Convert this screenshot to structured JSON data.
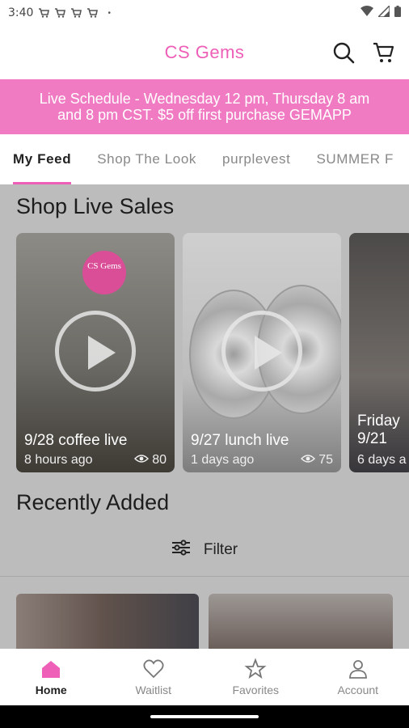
{
  "status": {
    "time": "3:40",
    "dot": "•",
    "icons": [
      "cart-icon",
      "cart-icon",
      "cart-icon",
      "cart-icon",
      "wifi-icon",
      "signal-icon",
      "battery-icon"
    ]
  },
  "header": {
    "title": "CS Gems",
    "icons": [
      "search-icon",
      "cart-icon"
    ],
    "title_color": "#ee5fb7"
  },
  "banner": {
    "line1": "Live Schedule - Wednesday 12 pm, Thursday 8 am",
    "line2": "and 8 pm CST.  $5 off first purchase GEMAPP",
    "bg_color": "#f07bc3"
  },
  "tabs": [
    {
      "label": "My Feed",
      "active": true
    },
    {
      "label": "Shop The Look",
      "active": false
    },
    {
      "label": "purplevest",
      "active": false
    },
    {
      "label": "SUMMER F",
      "active": false
    }
  ],
  "live_sales": {
    "title": "Shop Live Sales",
    "cards": [
      {
        "title": "9/28 coffee live",
        "subtitle": "8 hours ago",
        "views": "80",
        "logo_text": "CS Gems"
      },
      {
        "title": "9/27 lunch live",
        "subtitle": "1 days ago",
        "views": "75"
      },
      {
        "title": "Friday 9/21",
        "subtitle": "6 days a"
      }
    ]
  },
  "recently_added": {
    "title": "Recently Added",
    "filter_label": "Filter"
  },
  "bottom_nav": [
    {
      "label": "Home",
      "icon": "home-icon",
      "active": true
    },
    {
      "label": "Waitlist",
      "icon": "heart-icon",
      "active": false
    },
    {
      "label": "Favorites",
      "icon": "star-icon",
      "active": false
    },
    {
      "label": "Account",
      "icon": "account-icon",
      "active": false
    }
  ],
  "accent_color": "#ee5fb7"
}
